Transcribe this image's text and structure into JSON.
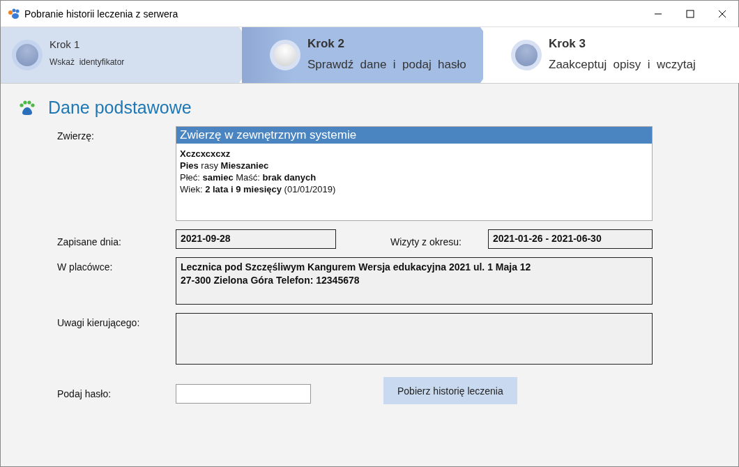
{
  "window": {
    "title": "Pobranie historii leczenia z serwera"
  },
  "steps": [
    {
      "title": "Krok 1",
      "subtitle": "Wskaż  identyfikator",
      "selected": false,
      "completed": true
    },
    {
      "title": "Krok 2",
      "subtitle": "Sprawdź  dane  i  podaj  hasło",
      "selected": true,
      "completed": false
    },
    {
      "title": "Krok 3",
      "subtitle": "Zaakceptuj  opisy  i  wczytaj",
      "selected": false,
      "completed": false
    }
  ],
  "section": {
    "title": "Dane podstawowe"
  },
  "animal": {
    "label": "Zwierzę:",
    "header": "Zwierzę w zewnętrznym systemie",
    "name": "Xczcxcxcxz",
    "lines": [
      "**Pies** rasy **Mieszaniec**",
      "Płeć: **samiec**  Maść: **brak danych**",
      "Wiek: **2 lata i 9 miesięcy** (01/01/2019)"
    ]
  },
  "saved": {
    "label": "Zapisane dnia:",
    "value": "2021-09-28"
  },
  "visits": {
    "label": "Wizyty z okresu:",
    "value": "2021-01-26 - 2021-06-30"
  },
  "clinic": {
    "label": "W placówce:",
    "lines": [
      "Lecznica pod Szczęśliwym Kangurem Wersja edukacyjna 2021 ul. 1 Maja 12",
      "27-300 Zielona Góra Telefon: 12345678"
    ]
  },
  "remarks": {
    "label": "Uwagi kierującego:"
  },
  "password": {
    "label": "Podaj hasło:"
  },
  "buttons": [
    {
      "label": "Pobierz historię leczenia"
    }
  ]
}
